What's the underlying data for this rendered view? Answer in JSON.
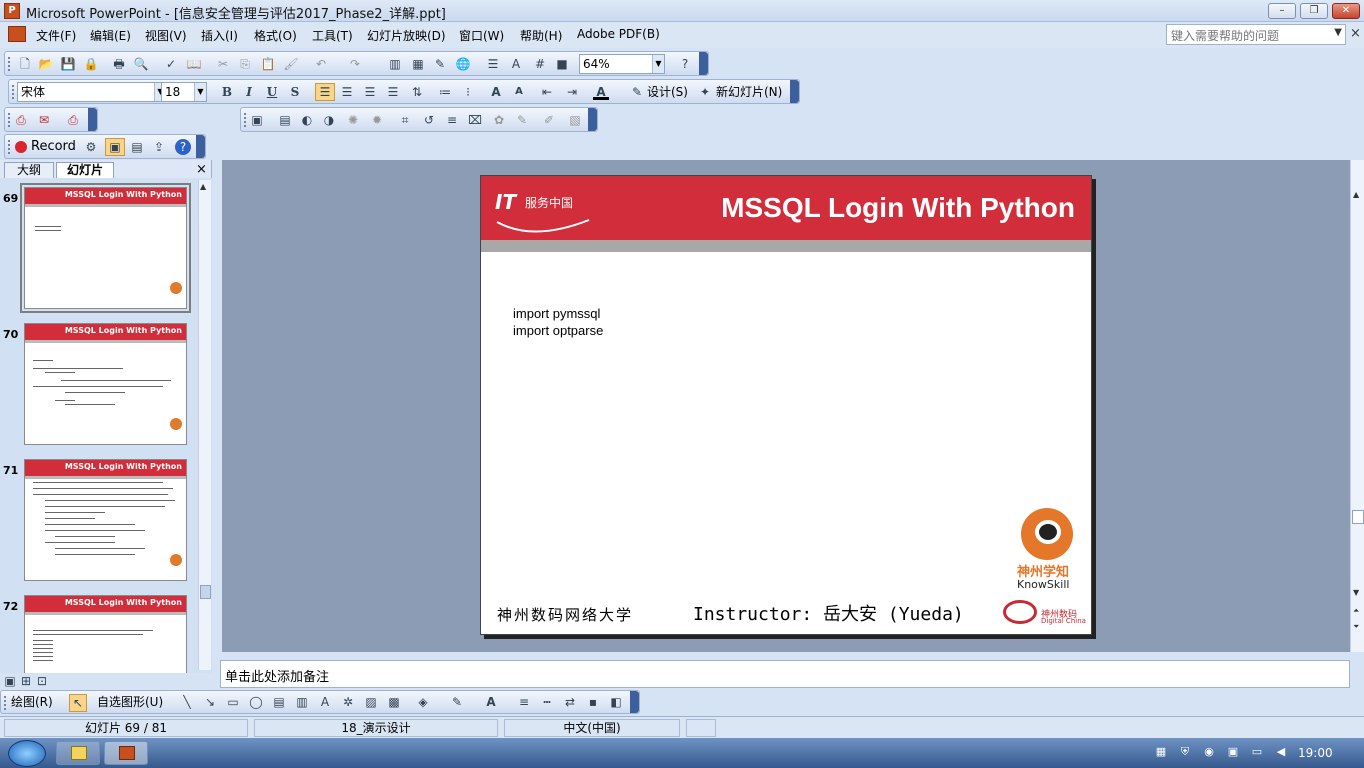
{
  "window": {
    "title": "Microsoft PowerPoint - [信息安全管理与评估2017_Phase2_详解.ppt]",
    "min_label": "–",
    "max_label": "❐",
    "close_label": "✕"
  },
  "menu": {
    "items": [
      "文件(F)",
      "编辑(E)",
      "视图(V)",
      "插入(I)",
      "格式(O)",
      "工具(T)",
      "幻灯片放映(D)",
      "窗口(W)",
      "帮助(H)",
      "Adobe PDF(B)"
    ],
    "help_placeholder": "键入需要帮助的问题",
    "doc_close": "×"
  },
  "toolbar_standard": {
    "zoom": "64%"
  },
  "toolbar_format": {
    "font_name": "宋体",
    "font_size": "18",
    "bold": "B",
    "italic": "I",
    "underline": "U",
    "shadow": "S",
    "design_label": "设计(S)",
    "new_slide_label": "新幻灯片(N)"
  },
  "toolbar_record": {
    "record_label": "Record"
  },
  "left_panel": {
    "tabs": [
      "大纲",
      "幻灯片"
    ],
    "close": "×",
    "thumbnails": [
      {
        "number": "69",
        "title": "MSSQL Login With Python"
      },
      {
        "number": "70",
        "title": "MSSQL Login With Python"
      },
      {
        "number": "71",
        "title": "MSSQL Login With Python"
      },
      {
        "number": "72",
        "title": "MSSQL Login With Python"
      }
    ]
  },
  "slide": {
    "title": "MSSQL Login With Python",
    "logo_it": "IT",
    "logo_sub": "服务中国",
    "code_lines": [
      "import pymssql",
      "import optparse"
    ],
    "footer_left": "神州数码网络大学",
    "footer_instructor": "Instructor: 岳大安 (Yueda)",
    "knowskill_cn": "神州学知",
    "knowskill_en": "KnowSkill",
    "dc_cn": "神州数码",
    "dc_en": "Digital China"
  },
  "notes": {
    "placeholder": "单击此处添加备注"
  },
  "draw_toolbar": {
    "draw_label": "绘图(R)",
    "autoshapes_label": "自选图形(U)"
  },
  "status": {
    "slide_info": "幻灯片 69 / 81",
    "design": "18_演示设计",
    "language": "中文(中国)"
  },
  "taskbar": {
    "clock": "19:00"
  }
}
